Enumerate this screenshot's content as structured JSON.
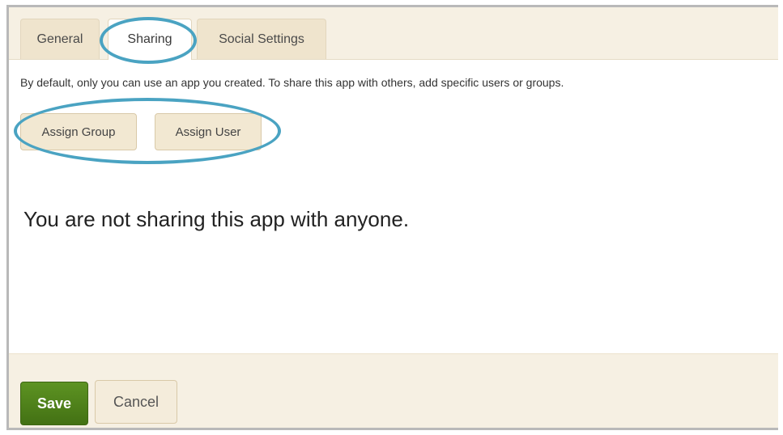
{
  "tabs": {
    "general": "General",
    "sharing": "Sharing",
    "social": "Social Settings"
  },
  "sharing": {
    "info": "By default, only you can use an app you created. To share this app with others, add specific users or groups.",
    "assign_group": "Assign Group",
    "assign_user": "Assign User",
    "empty_message": "You are not sharing this app with anyone."
  },
  "footer": {
    "save": "Save",
    "cancel": "Cancel"
  },
  "colors": {
    "annotation": "#4aa3c2",
    "save_button": "#4f8419",
    "panel_beige": "#f6f0e3"
  }
}
